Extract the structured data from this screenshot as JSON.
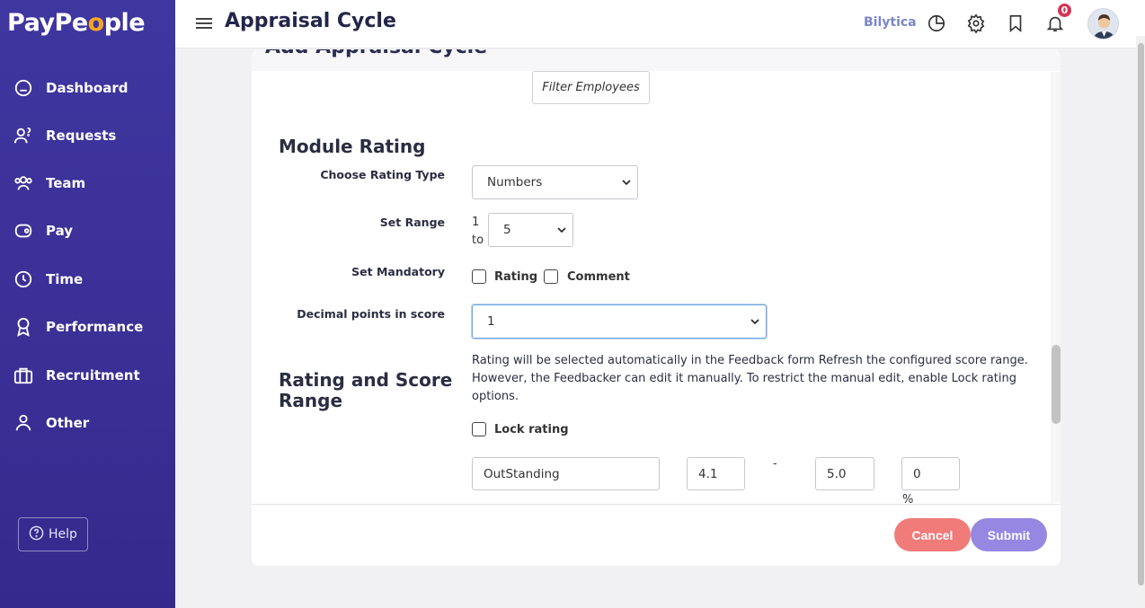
{
  "brand": {
    "logo_pre": "PayPe",
    "logo_o": "o",
    "logo_post": "ple",
    "accent": "#f5a623",
    "sidebar_color": "#3a2f95"
  },
  "sidebar": {
    "items": [
      {
        "label": "Dashboard",
        "icon": "dashboard-icon"
      },
      {
        "label": "Requests",
        "icon": "requests-icon"
      },
      {
        "label": "Team",
        "icon": "team-icon"
      },
      {
        "label": "Pay",
        "icon": "wallet-icon"
      },
      {
        "label": "Time",
        "icon": "clock-icon"
      },
      {
        "label": "Performance",
        "icon": "award-icon"
      },
      {
        "label": "Recruitment",
        "icon": "briefcase-icon"
      },
      {
        "label": "Other",
        "icon": "user-icon"
      }
    ],
    "help_label": "Help"
  },
  "header": {
    "title": "Appraisal Cycle",
    "company": "Bilytica",
    "notification_count": "0",
    "icons": [
      "pie-chart-icon",
      "gear-icon",
      "bookmark-icon",
      "bell-icon"
    ]
  },
  "card": {
    "title": "Add Appraisal Cycle",
    "filter_button": "Filter Employees",
    "module_rating": {
      "section_title": "Module Rating",
      "rating_type_label": "Choose Rating Type",
      "rating_type_value": "Numbers",
      "range_label": "Set Range",
      "range_from": "1",
      "range_to_word": "to",
      "range_to_value": "5",
      "mandatory_label": "Set Mandatory",
      "mandatory_rating": "Rating",
      "mandatory_comment": "Comment",
      "decimal_label": "Decimal points in score",
      "decimal_value": "1"
    },
    "score_range": {
      "section_title_line1": "Rating and Score",
      "section_title_line2": "Range",
      "info": "Rating will be selected automatically in the Feedback form Refresh the configured score range. However, the Feedbacker can edit it manually. To restrict the manual edit, enable Lock rating options.",
      "lock_label": "Lock rating",
      "row": {
        "name": "OutStanding",
        "min": "4.1",
        "dash": "-",
        "max": "5.0",
        "percent": "0",
        "percent_sign": "%"
      }
    },
    "footer": {
      "cancel": "Cancel",
      "submit": "Submit",
      "cancel_color": "#f07b79",
      "submit_color": "#9587e2"
    }
  }
}
